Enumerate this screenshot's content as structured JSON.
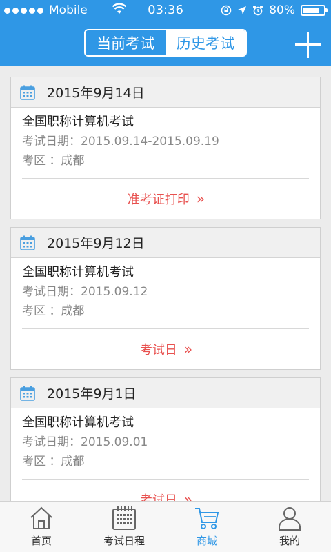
{
  "status_bar": {
    "carrier": "Mobile",
    "time": "03:36",
    "battery": "80%",
    "battery_level": 0.8
  },
  "header": {
    "tabs": [
      {
        "label": "当前考试",
        "active": false
      },
      {
        "label": "历史考试",
        "active": true
      }
    ],
    "add_icon": "plus-icon"
  },
  "colors": {
    "primary": "#2f97e6",
    "action_red": "#e8514f",
    "background": "#ececec"
  },
  "exams": [
    {
      "date": "2015年9月14日",
      "name": "全国职称计算机考试",
      "exam_date": "考试日期：2015.09.14-2015.09.19",
      "region": "考区 ：成都",
      "action": "准考证打印"
    },
    {
      "date": "2015年9月12日",
      "name": "全国职称计算机考试",
      "exam_date": "考试日期：2015.09.12",
      "region": "考区 ：成都",
      "action": "考试日"
    },
    {
      "date": "2015年9月1日",
      "name": "全国职称计算机考试",
      "exam_date": "考试日期：2015.09.01",
      "region": "考区 ：成都",
      "action": "考试日"
    }
  ],
  "chevron": "»",
  "tab_bar": [
    {
      "label": "首页",
      "icon": "home-icon",
      "active": false
    },
    {
      "label": "考试日程",
      "icon": "calendar-icon",
      "active": false
    },
    {
      "label": "商城",
      "icon": "cart-icon",
      "active": true
    },
    {
      "label": "我的",
      "icon": "user-icon",
      "active": false
    }
  ]
}
